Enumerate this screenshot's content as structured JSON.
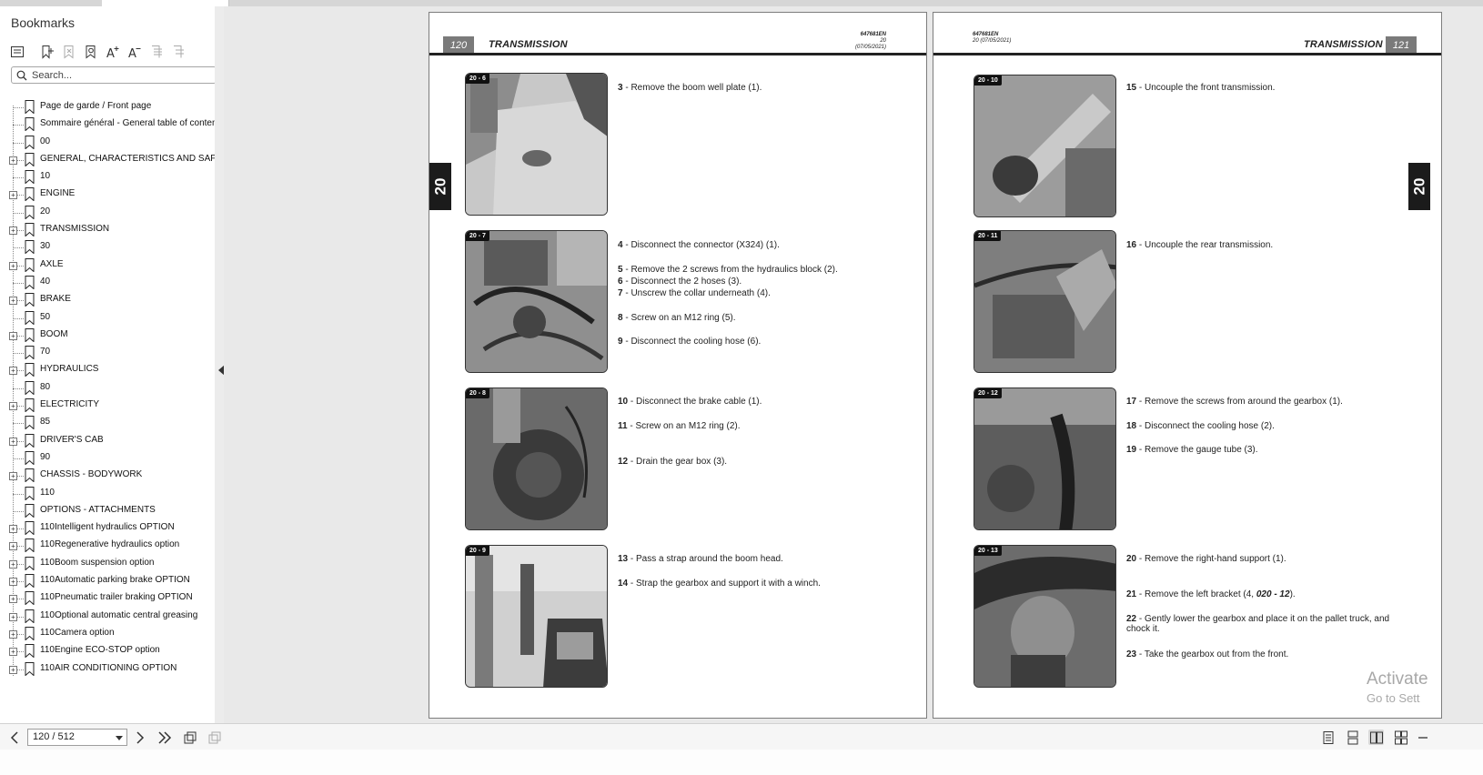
{
  "sidebar": {
    "title": "Bookmarks",
    "search_placeholder": "Search...",
    "items": [
      {
        "label": "Page de garde / Front page",
        "expandable": false
      },
      {
        "label": "Sommaire général - General table of content",
        "expandable": false
      },
      {
        "label": "00",
        "expandable": false
      },
      {
        "label": "GENERAL, CHARACTERISTICS AND SAFETY",
        "expandable": true
      },
      {
        "label": "10",
        "expandable": false
      },
      {
        "label": "ENGINE",
        "expandable": true
      },
      {
        "label": "20",
        "expandable": false
      },
      {
        "label": "TRANSMISSION",
        "expandable": true
      },
      {
        "label": "30",
        "expandable": false
      },
      {
        "label": "AXLE",
        "expandable": true
      },
      {
        "label": "40",
        "expandable": false
      },
      {
        "label": "BRAKE",
        "expandable": true
      },
      {
        "label": "50",
        "expandable": false
      },
      {
        "label": "BOOM",
        "expandable": true
      },
      {
        "label": "70",
        "expandable": false
      },
      {
        "label": "HYDRAULICS",
        "expandable": true
      },
      {
        "label": "80",
        "expandable": false
      },
      {
        "label": "ELECTRICITY",
        "expandable": true
      },
      {
        "label": "85",
        "expandable": false
      },
      {
        "label": "DRIVER'S CAB",
        "expandable": true
      },
      {
        "label": "90",
        "expandable": false
      },
      {
        "label": "CHASSIS - BODYWORK",
        "expandable": true
      },
      {
        "label": "110",
        "expandable": false
      },
      {
        "label": "OPTIONS - ATTACHMENTS",
        "expandable": false
      },
      {
        "label": "110Intelligent hydraulics OPTION",
        "expandable": true
      },
      {
        "label": "110Regenerative hydraulics option",
        "expandable": true
      },
      {
        "label": "110Boom suspension option",
        "expandable": true
      },
      {
        "label": "110Automatic parking brake OPTION",
        "expandable": true
      },
      {
        "label": "110Pneumatic trailer braking OPTION",
        "expandable": true
      },
      {
        "label": "110Optional automatic central greasing",
        "expandable": true
      },
      {
        "label": "110Camera option",
        "expandable": true
      },
      {
        "label": "110Engine ECO-STOP option",
        "expandable": true
      },
      {
        "label": "110AIR CONDITIONING OPTION",
        "expandable": true
      }
    ]
  },
  "pages": {
    "left": {
      "page_number": "120",
      "title": "TRANSMISSION",
      "doc_code": "647681EN",
      "doc_date": "20 (07/05/2021)",
      "chapter": "20",
      "figures": [
        "20 - 6",
        "20 - 7",
        "20 - 8",
        "20 - 9"
      ],
      "steps": [
        {
          "num": "3",
          "text": "Remove the boom well plate (1)."
        },
        {
          "num": "4",
          "text": "Disconnect the connector (X324) (1)."
        },
        {
          "num": "5",
          "text": "Remove the 2 screws from the hydraulics block (2)."
        },
        {
          "num": "6",
          "text": "Disconnect the 2 hoses (3)."
        },
        {
          "num": "7",
          "text": "Unscrew the collar underneath (4)."
        },
        {
          "num": "8",
          "text": "Screw on an M12 ring (5)."
        },
        {
          "num": "9",
          "text": "Disconnect the cooling hose (6)."
        },
        {
          "num": "10",
          "text": "Disconnect the brake cable (1)."
        },
        {
          "num": "11",
          "text": "Screw on an M12 ring (2)."
        },
        {
          "num": "12",
          "text": "Drain the gear box (3)."
        },
        {
          "num": "13",
          "text": "Pass a strap around the boom head."
        },
        {
          "num": "14",
          "text": "Strap the gearbox and support it with a winch."
        }
      ]
    },
    "right": {
      "page_number": "121",
      "title": "TRANSMISSION",
      "doc_code": "647681EN",
      "doc_date": "20 (07/05/2021)",
      "chapter": "20",
      "figures": [
        "20 - 10",
        "20 - 11",
        "20 - 12",
        "20 - 13"
      ],
      "steps": [
        {
          "num": "15",
          "text": "Uncouple the front transmission."
        },
        {
          "num": "16",
          "text": "Uncouple the rear transmission."
        },
        {
          "num": "17",
          "text": "Remove the screws from around the gearbox (1)."
        },
        {
          "num": "18",
          "text": "Disconnect the cooling hose (2)."
        },
        {
          "num": "19",
          "text": "Remove the gauge tube (3)."
        },
        {
          "num": "20",
          "text": "Remove the right-hand support (1)."
        },
        {
          "num": "21",
          "text": "Remove the left bracket (4, ",
          "ref": "020 - 12",
          "suffix": ")."
        },
        {
          "num": "22",
          "text": "Gently lower the gearbox and place it on the pallet truck, and chock it."
        },
        {
          "num": "23",
          "text": "Take the gearbox out from the front."
        }
      ]
    }
  },
  "watermark": {
    "line1": "Activate",
    "line2": "Go to Sett"
  },
  "bottombar": {
    "page_indicator": "120 / 512"
  },
  "icons": {
    "toolbar": [
      "bookmark-list-icon",
      "add-bookmark-icon",
      "delete-bookmark-icon",
      "find-bookmark-icon",
      "increase-font-icon",
      "decrease-font-icon",
      "expand-all-icon",
      "collapse-all-icon"
    ],
    "bottombar": [
      "previous-page-icon",
      "next-page-icon",
      "last-page-icon",
      "rotate-page-icon",
      "copy-page-icon",
      "single-page-icon",
      "continuous-page-icon",
      "two-page-icon",
      "two-page-continuous-icon"
    ]
  },
  "colors": {
    "chapter_tab": "#1b1b1b",
    "page_tab": "#7a7a7a"
  }
}
